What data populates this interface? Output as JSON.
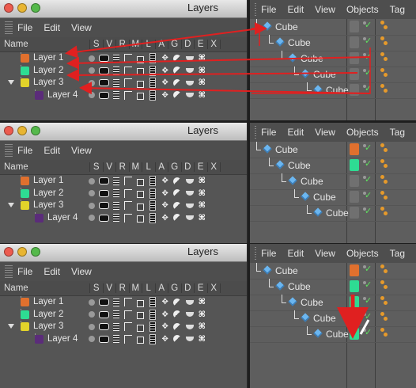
{
  "window_title": "Layers",
  "layers_menu": [
    "File",
    "Edit",
    "View"
  ],
  "layers_columns": [
    "Name",
    "S",
    "V",
    "R",
    "M",
    "L",
    "A",
    "G",
    "D",
    "E",
    "X"
  ],
  "layers": [
    {
      "label": "Layer 1",
      "color": "#e0702e"
    },
    {
      "label": "Layer 2",
      "color": "#2edc93"
    },
    {
      "label": "Layer 3",
      "color": "#e2d32a"
    },
    {
      "label": "Layer 4",
      "color": "#5b2c7a"
    }
  ],
  "objects_menu": [
    "File",
    "Edit",
    "View",
    "Objects",
    "Tag"
  ],
  "objects": [
    {
      "label": "Cube"
    },
    {
      "label": "Cube"
    },
    {
      "label": "Cube"
    },
    {
      "label": "Cube"
    },
    {
      "label": "Cube"
    }
  ],
  "frame_object_colors": [
    [
      "#707070",
      "#707070",
      "#707070",
      "#707070",
      "#707070"
    ],
    [
      "#e0702e",
      "#2edc93",
      "#707070",
      "#707070",
      "#707070"
    ],
    [
      "#e0702e",
      "#2edc93",
      "#2edc93",
      "#2edc93",
      "#2edc93"
    ]
  ],
  "accent_arrow_color": "#e02020"
}
